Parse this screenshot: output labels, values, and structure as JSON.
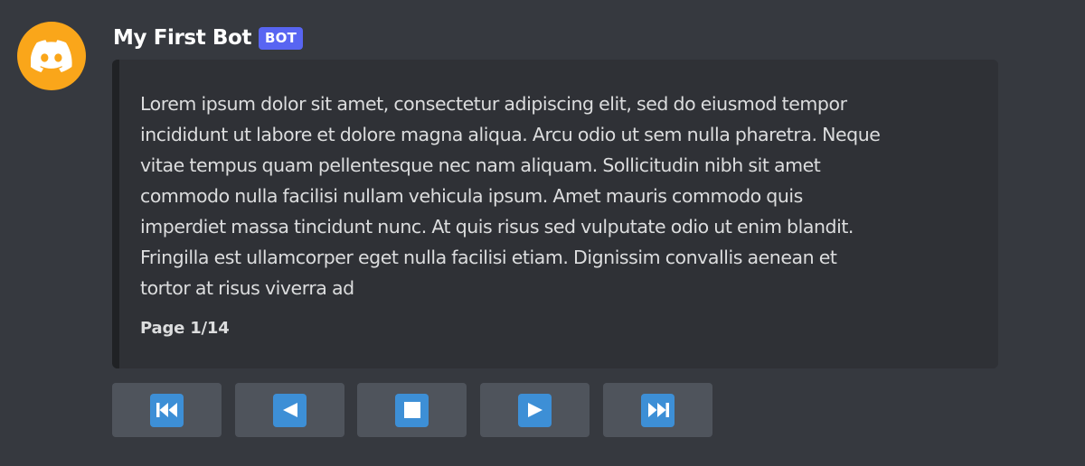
{
  "message": {
    "username": "My First Bot",
    "bot_tag": "BOT",
    "avatar_icon": "discord-logo-icon",
    "avatar_color": "#faa61a"
  },
  "embed": {
    "description": "Lorem ipsum dolor sit amet, consectetur adipiscing elit, sed do eiusmod tempor\nincididunt ut labore et dolore magna aliqua. Arcu odio ut sem nulla pharetra. Neque\nvitae tempus quam pellentesque nec nam aliquam. Sollicitudin nibh sit amet\ncommodo nulla facilisi nullam vehicula ipsum. Amet mauris commodo quis\nimperdiet massa tincidunt nunc. At quis risus sed vulputate odio ut enim blandit.\nFringilla est ullamcorper eget nulla facilisi etiam. Dignissim convallis aenean et\ntortor at risus viverra ad",
    "footer": "Page 1/14"
  },
  "buttons": [
    {
      "icon": "first-page-icon"
    },
    {
      "icon": "previous-page-icon"
    },
    {
      "icon": "stop-icon"
    },
    {
      "icon": "next-page-icon"
    },
    {
      "icon": "last-page-icon"
    }
  ],
  "colors": {
    "background": "#36393f",
    "embed_background": "#2f3136",
    "bot_tag": "#5865f2",
    "button": "#4f545c",
    "button_icon": "#3d8fd6"
  }
}
